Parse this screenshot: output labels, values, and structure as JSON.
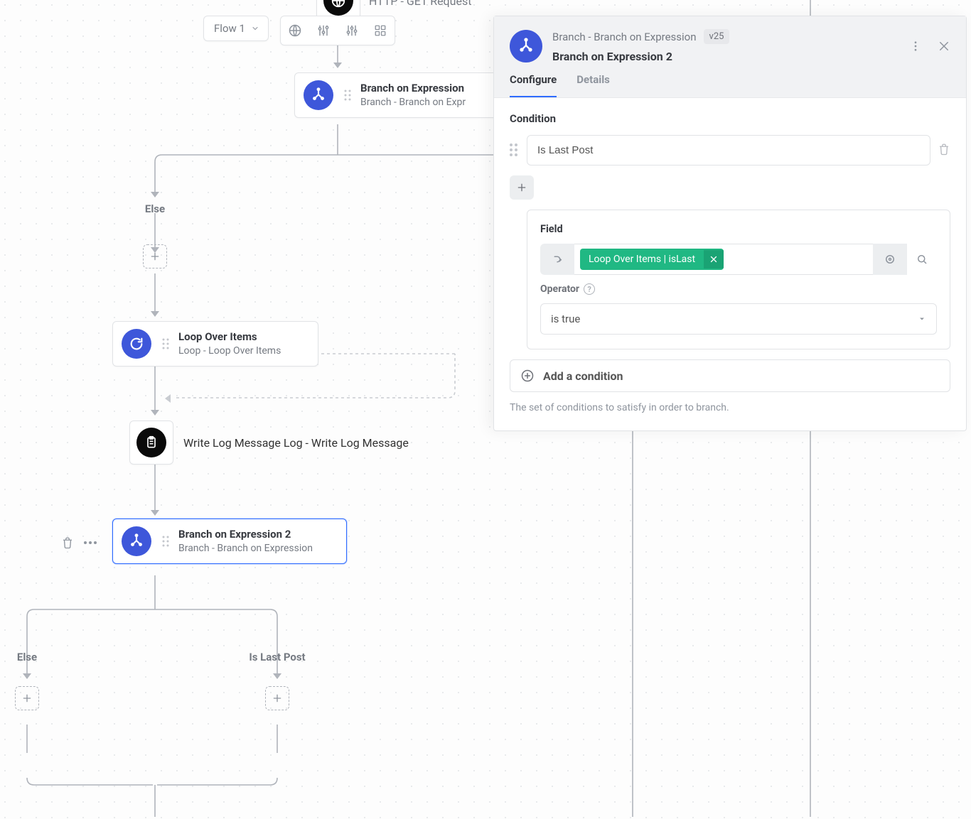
{
  "toolbar": {
    "flow_label": "Flow 1"
  },
  "canvas": {
    "http_node": {
      "subtitle": "HTTP - GET Request"
    },
    "branch1": {
      "title": "Branch on Expression",
      "subtitle": "Branch - Branch on Expr"
    },
    "else_label": "Else",
    "loop": {
      "title": "Loop Over Items",
      "subtitle": "Loop - Loop Over Items"
    },
    "log": {
      "title": "Write Log Message",
      "subtitle": "Log - Write Log Message"
    },
    "branch2": {
      "title": "Branch on Expression 2",
      "subtitle": "Branch - Branch on Expression"
    },
    "b2_else": "Else",
    "b2_cond": "Is Last Post"
  },
  "panel": {
    "breadcrumb": "Branch - Branch on Expression",
    "version": "v25",
    "title": "Branch on Expression 2",
    "tabs": {
      "configure": "Configure",
      "details": "Details"
    },
    "condition_heading": "Condition",
    "condition_name": "Is Last Post",
    "field_label": "Field",
    "field_chip": "Loop Over Items | isLast",
    "operator_label": "Operator",
    "operator_value": "is true",
    "add_condition": "Add a condition",
    "hint": "The set of conditions to satisfy in order to branch."
  }
}
